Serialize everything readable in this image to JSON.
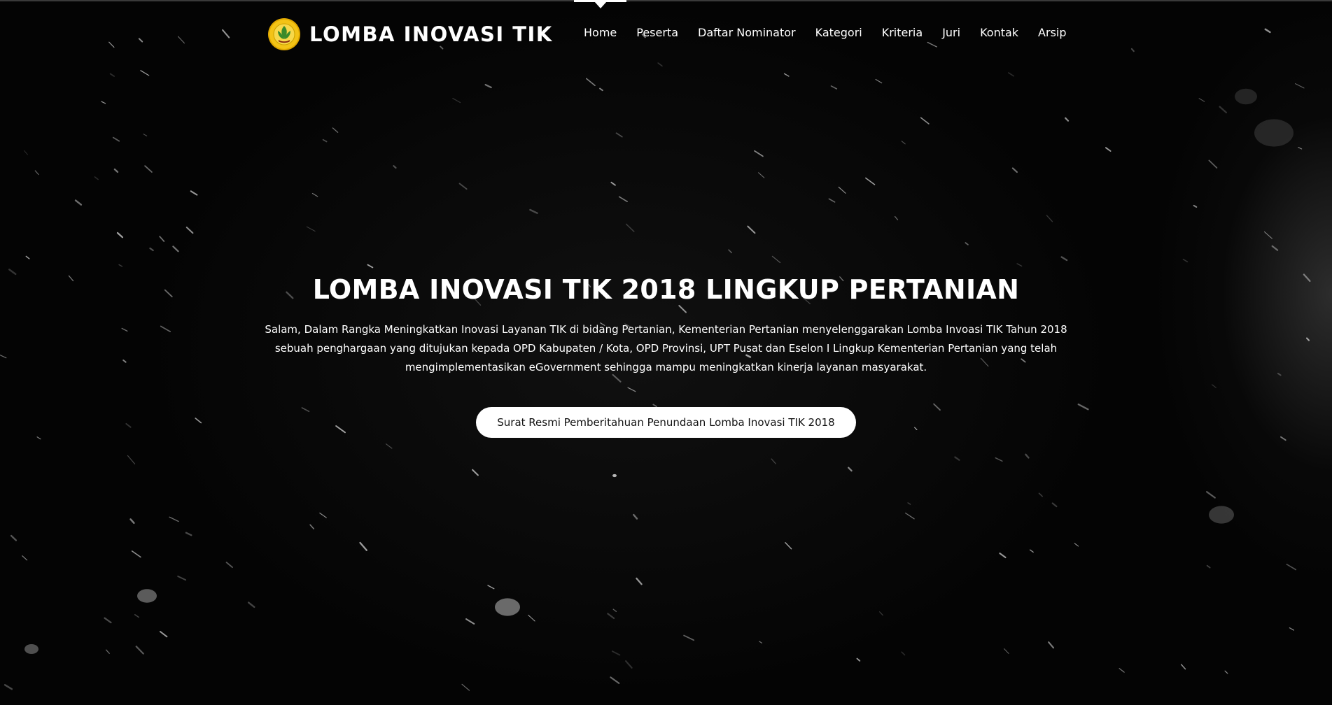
{
  "brand": {
    "logo_icon": "ministry-of-agriculture-emblem-icon",
    "name": "LOMBA INOVASI TIK"
  },
  "nav": {
    "items": [
      {
        "label": "Home",
        "active": true
      },
      {
        "label": "Peserta",
        "active": false
      },
      {
        "label": "Daftar Nominator",
        "active": false
      },
      {
        "label": "Kategori",
        "active": false
      },
      {
        "label": "Kriteria",
        "active": false
      },
      {
        "label": "Juri",
        "active": false
      },
      {
        "label": "Kontak",
        "active": false
      },
      {
        "label": "Arsip",
        "active": false
      }
    ]
  },
  "hero": {
    "title": "LOMBA INOVASI TIK 2018 LINGKUP PERTANIAN",
    "description": "Salam, Dalam Rangka Meningkatkan Inovasi Layanan TIK di bidang Pertanian, Kementerian Pertanian menyelenggarakan Lomba Invoasi TIK Tahun 2018 sebuah penghargaan yang ditujukan kepada OPD Kabupaten / Kota, OPD Provinsi, UPT Pusat dan Eselon I Lingkup Kementerian Pertanian yang telah mengimplementasikan eGovernment sehingga mampu meningkatkan kinerja layanan masyarakat.",
    "button_label": "Surat Resmi Pemberitahuan Penundaan Lomba Inovasi TIK 2018"
  },
  "colors": {
    "background": "#040404",
    "text": "#ffffff",
    "button_bg": "#ffffff",
    "button_text": "#111111",
    "logo_yellow": "#f3c316",
    "logo_green": "#3a8a2a"
  }
}
